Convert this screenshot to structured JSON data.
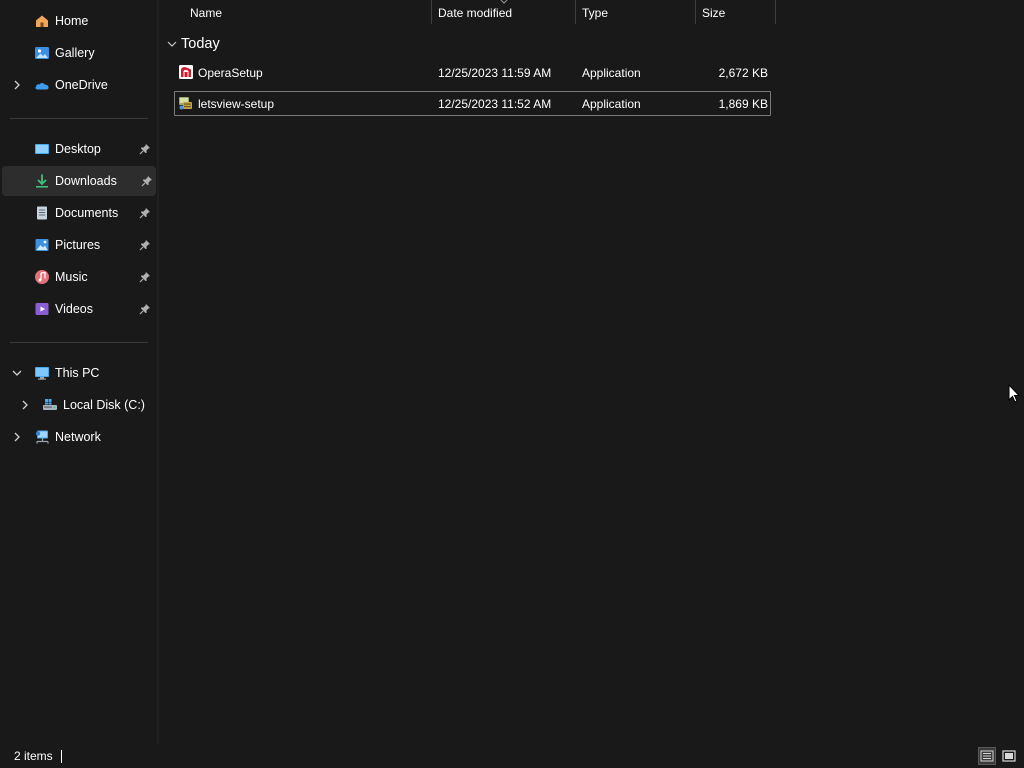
{
  "sidebar": {
    "quick": [
      {
        "label": "Home",
        "icon": "home-icon"
      },
      {
        "label": "Gallery",
        "icon": "gallery-icon"
      },
      {
        "label": "OneDrive",
        "icon": "onedrive-icon"
      }
    ],
    "pinned": [
      {
        "label": "Desktop",
        "icon": "desktop-icon"
      },
      {
        "label": "Downloads",
        "icon": "downloads-icon",
        "selected": true
      },
      {
        "label": "Documents",
        "icon": "documents-icon"
      },
      {
        "label": "Pictures",
        "icon": "pictures-icon"
      },
      {
        "label": "Music",
        "icon": "music-icon"
      },
      {
        "label": "Videos",
        "icon": "videos-icon"
      }
    ],
    "tree": [
      {
        "label": "This PC",
        "icon": "this-pc-icon",
        "expanded": true
      },
      {
        "label": "Local Disk (C:)",
        "icon": "local-disk-icon"
      },
      {
        "label": "Network",
        "icon": "network-icon"
      }
    ]
  },
  "columns": {
    "name": "Name",
    "date_modified": "Date modified",
    "type": "Type",
    "size": "Size"
  },
  "groups": [
    {
      "title": "Today",
      "files": [
        {
          "name": "OperaSetup",
          "date": "12/25/2023 11:59 AM",
          "type": "Application",
          "size": "2,672 KB",
          "icon": "opera-installer-icon"
        },
        {
          "name": "letsview-setup",
          "date": "12/25/2023 11:52 AM",
          "type": "Application",
          "size": "1,869 KB",
          "icon": "setup-installer-icon",
          "focused": true
        }
      ]
    }
  ],
  "status": {
    "item_count": "2 items",
    "view_modes": [
      "details-view-icon",
      "tiles-view-icon"
    ]
  },
  "colors": {
    "background": "#191919",
    "selected_item": "#2d2d2d",
    "accent_blue": "#4aa8ec",
    "downloads_green": "#3fbf7f"
  }
}
